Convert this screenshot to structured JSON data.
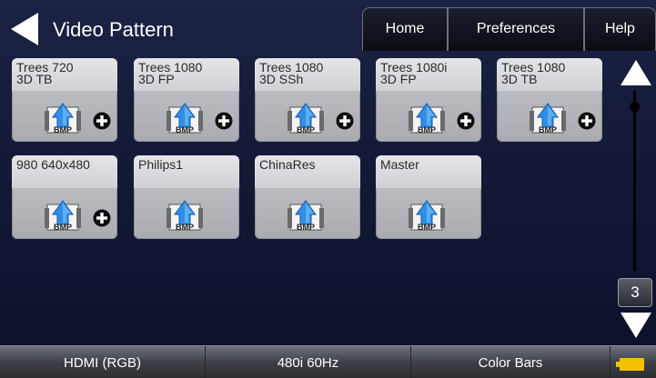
{
  "header": {
    "title": "Video Pattern",
    "tabs": [
      {
        "label": "Home"
      },
      {
        "label": "Preferences"
      },
      {
        "label": "Help"
      }
    ]
  },
  "tiles": [
    {
      "label": "Trees 720\n3D TB",
      "icon": "bmp-file-icon",
      "has_plus": true
    },
    {
      "label": "Trees 1080\n3D FP",
      "icon": "bmp-file-icon",
      "has_plus": true
    },
    {
      "label": "Trees 1080\n3D SSh",
      "icon": "bmp-file-icon",
      "has_plus": true
    },
    {
      "label": "Trees 1080i\n3D FP",
      "icon": "bmp-file-icon",
      "has_plus": true
    },
    {
      "label": "Trees 1080\n3D TB",
      "icon": "bmp-file-icon",
      "has_plus": true
    },
    {
      "label": "980 640x480",
      "icon": "bmp-file-icon",
      "has_plus": true
    },
    {
      "label": "Philips1",
      "icon": "bmp-file-icon",
      "has_plus": false
    },
    {
      "label": "ChinaRes",
      "icon": "bmp-file-icon",
      "has_plus": false
    },
    {
      "label": "Master",
      "icon": "bmp-file-icon",
      "has_plus": false
    }
  ],
  "bmp_icon_text": "BMP",
  "scroll": {
    "page": "3"
  },
  "status": {
    "interface": "HDMI (RGB)",
    "format": "480i 60Hz",
    "pattern": "Color Bars"
  },
  "colors": {
    "background": "#151b38",
    "tile": "#c5c7cc",
    "battery": "#f2c200"
  }
}
